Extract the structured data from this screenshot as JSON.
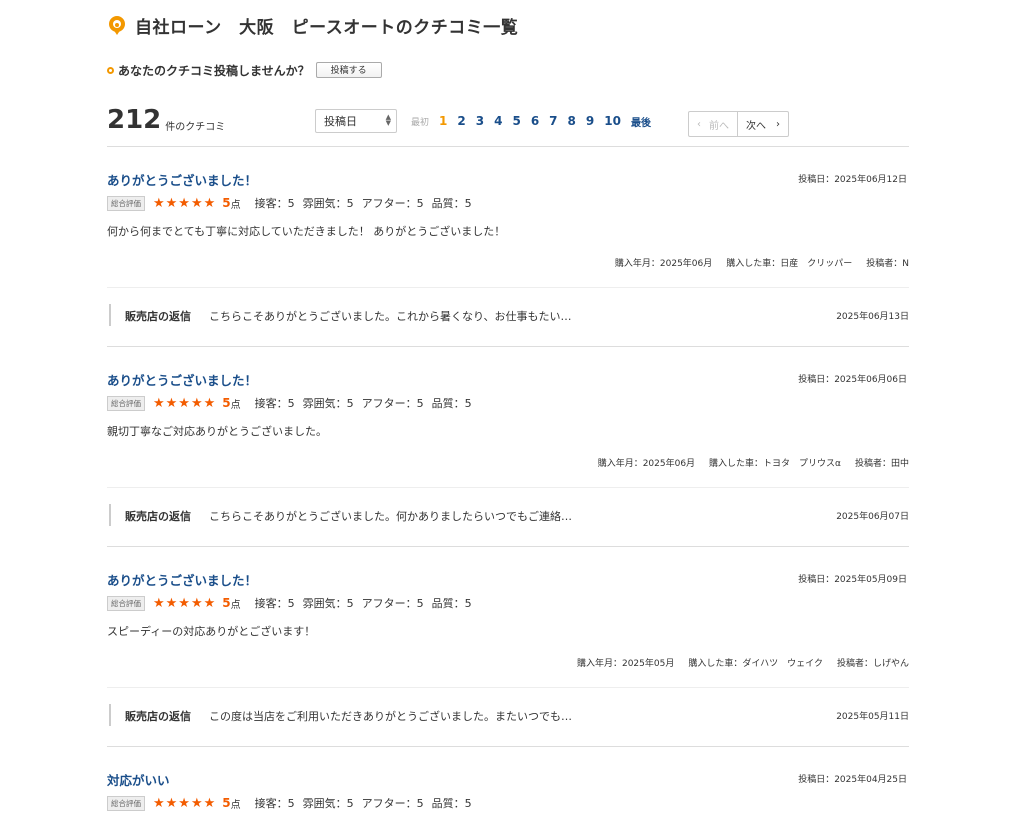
{
  "page": {
    "title": "自社ローン　大阪　ピースオートのクチコミ一覧",
    "post_question": "あなたのクチコミ投稿しませんか？",
    "post_button": "投稿する"
  },
  "summary": {
    "count": "212",
    "count_label": "件のクチコミ"
  },
  "sort": {
    "selected": "投稿日"
  },
  "pager": {
    "first": "最初",
    "pages": [
      "1",
      "2",
      "3",
      "4",
      "5",
      "6",
      "7",
      "8",
      "9",
      "10"
    ],
    "current": "1",
    "last": "最後",
    "prev": "前へ",
    "next": "次へ"
  },
  "reviews": [
    {
      "title": "ありがとうございました！",
      "date": "投稿日：2025年06月12日",
      "badge": "総合評価",
      "stars": "★★★★★",
      "score": "5",
      "score_unit": "点",
      "sub1": "接客：5",
      "sub2": "雰囲気：5",
      "sub3": "アフター：5",
      "sub4": "品質：5",
      "body": "何から何までとても丁寧に対応していただきました！ ありがとうございました！",
      "meta1": "購入年月：2025年06月",
      "meta2": "購入した車：日産　クリッパー",
      "meta3": "投稿者：N",
      "reply_label": "販売店の返信",
      "reply_text": "こちらこそありがとうございました。これから暑くなり、お仕事もたい…",
      "reply_date": "2025年06月13日"
    },
    {
      "title": "ありがとうございました！",
      "date": "投稿日：2025年06月06日",
      "badge": "総合評価",
      "stars": "★★★★★",
      "score": "5",
      "score_unit": "点",
      "sub1": "接客：5",
      "sub2": "雰囲気：5",
      "sub3": "アフター：5",
      "sub4": "品質：5",
      "body": "親切丁寧なご対応ありがとうございました。",
      "meta1": "購入年月：2025年06月",
      "meta2": "購入した車：トヨタ　プリウスα",
      "meta3": "投稿者：田中",
      "reply_label": "販売店の返信",
      "reply_text": "こちらこそありがとうございました。何かありましたらいつでもご連絡…",
      "reply_date": "2025年06月07日"
    },
    {
      "title": "ありがとうございました！",
      "date": "投稿日：2025年05月09日",
      "badge": "総合評価",
      "stars": "★★★★★",
      "score": "5",
      "score_unit": "点",
      "sub1": "接客：5",
      "sub2": "雰囲気：5",
      "sub3": "アフター：5",
      "sub4": "品質：5",
      "body": "スピーディーの対応ありがとございます！",
      "meta1": "購入年月：2025年05月",
      "meta2": "購入した車：ダイハツ　ウェイク",
      "meta3": "投稿者：しげやん",
      "reply_label": "販売店の返信",
      "reply_text": "この度は当店をご利用いただきありがとうございました。またいつでも…",
      "reply_date": "2025年05月11日"
    },
    {
      "title": "対応がいい",
      "date": "投稿日：2025年04月25日",
      "badge": "総合評価",
      "stars": "★★★★★",
      "score": "5",
      "score_unit": "点",
      "sub1": "接客：5",
      "sub2": "雰囲気：5",
      "sub3": "アフター：5",
      "sub4": "品質：5"
    }
  ],
  "colors": {
    "accent_orange": "#f39800",
    "star": "#f35c00",
    "link_blue": "#1a4e8a"
  }
}
